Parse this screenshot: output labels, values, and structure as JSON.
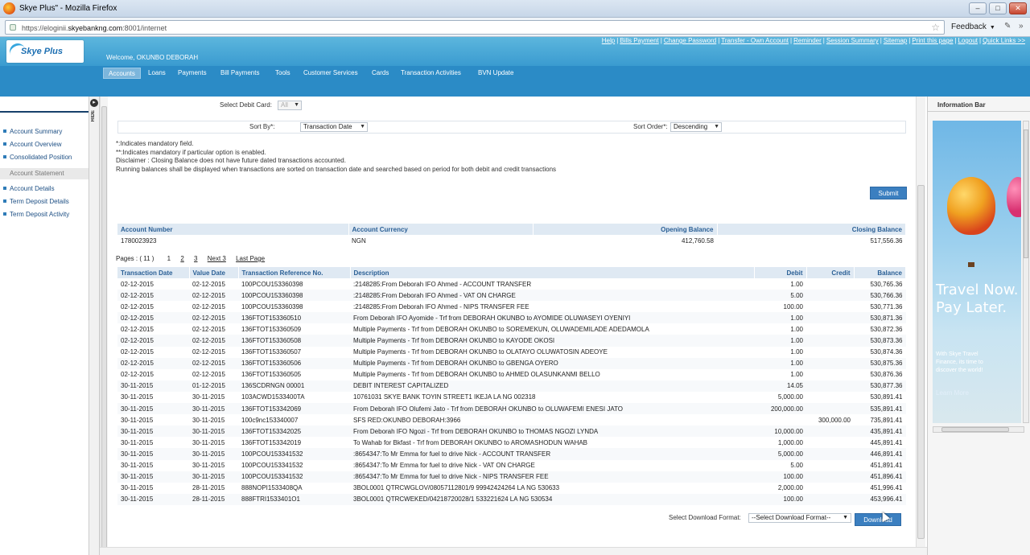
{
  "browser": {
    "window_title": "Skye Plus\" - Mozilla Firefox",
    "url_prefix": "https://eloginii.",
    "url_domain": "skyebankng.com",
    "url_suffix": ":8001/internet",
    "feedback_label": "Feedback",
    "minimize": "–",
    "maximize": "□",
    "close": "✕"
  },
  "header": {
    "logo_text": "Skye Plus",
    "welcome": "Welcome, OKUNBO DEBORAH",
    "quick_links": [
      "Help",
      "Bills Payment",
      "Change Password",
      "Transfer - Own Account",
      "Reminder",
      "Session Summary",
      "Sitemap",
      "Print this page",
      "Logout",
      "Quick Links >>"
    ]
  },
  "nav": {
    "items": [
      "Accounts",
      "Loans",
      "Payments",
      "Bill Payments",
      "Tools",
      "Customer Services",
      "Cards",
      "Transaction Activities",
      "BVN Update"
    ],
    "active": "Accounts"
  },
  "sidebar": {
    "hide_label": "HIDE",
    "items": [
      "Account Summary",
      "Account Overview",
      "Consolidated Position",
      "Account Statement",
      "Account Details",
      "Term Deposit Details",
      "Term Deposit Activity"
    ],
    "selected": "Account Statement"
  },
  "filters": {
    "debit_card_label": "Select Debit Card:",
    "debit_card_value": "All",
    "sort_by_label": "Sort By*:",
    "sort_by_value": "Transaction Date",
    "sort_order_label": "Sort Order*:",
    "sort_order_value": "Descending"
  },
  "notes": [
    "*:Indicates mandatory field.",
    "**:Indicates mandatory if particular option is enabled.",
    "Disclaimer : Closing Balance does not have future dated transactions accounted.",
    "Running balances shall be displayed when transactions are sorted on transaction date and searched based on period for both debit and credit transactions"
  ],
  "submit_label": "Submit",
  "summary": {
    "headers": [
      "Account Number",
      "Account Currency",
      "Opening Balance",
      "Closing Balance"
    ],
    "row": [
      "1780023923",
      "NGN",
      "412,760.58",
      "517,556.36"
    ]
  },
  "pager": {
    "pages_label": "Pages : ( 11 )",
    "current": "1",
    "links": [
      "2",
      "3",
      "Next 3",
      "Last Page"
    ]
  },
  "transactions": {
    "headers": [
      "Transaction Date",
      "Value Date",
      "Transaction Reference No.",
      "Description",
      "Debit",
      "Credit",
      "Balance"
    ],
    "rows": [
      [
        "02-12-2015",
        "02-12-2015",
        "100PCOU153360398",
        ":2148285:From Deborah IFO Ahmed - ACCOUNT TRANSFER",
        "1.00",
        "",
        "530,765.36"
      ],
      [
        "02-12-2015",
        "02-12-2015",
        "100PCOU153360398",
        ":2148285:From Deborah IFO Ahmed - VAT ON CHARGE",
        "5.00",
        "",
        "530,766.36"
      ],
      [
        "02-12-2015",
        "02-12-2015",
        "100PCOU153360398",
        ":2148285:From Deborah IFO Ahmed - NIPS TRANSFER FEE",
        "100.00",
        "",
        "530,771.36"
      ],
      [
        "02-12-2015",
        "02-12-2015",
        "136FTOT153360510",
        "From Deborah IFO Ayomide - Trf from DEBORAH OKUNBO to AYOMIDE OLUWASEYI OYENIYI",
        "1.00",
        "",
        "530,871.36"
      ],
      [
        "02-12-2015",
        "02-12-2015",
        "136FTOT153360509",
        "Multiple Payments - Trf from DEBORAH OKUNBO to SOREMEKUN, OLUWADEMILADE ADEDAMOLA",
        "1.00",
        "",
        "530,872.36"
      ],
      [
        "02-12-2015",
        "02-12-2015",
        "136FTOT153360508",
        "Multiple Payments - Trf from DEBORAH OKUNBO to KAYODE OKOSI",
        "1.00",
        "",
        "530,873.36"
      ],
      [
        "02-12-2015",
        "02-12-2015",
        "136FTOT153360507",
        "Multiple Payments - Trf from DEBORAH OKUNBO to OLATAYO OLUWATOSIN ADEOYE",
        "1.00",
        "",
        "530,874.36"
      ],
      [
        "02-12-2015",
        "02-12-2015",
        "136FTOT153360506",
        "Multiple Payments - Trf from DEBORAH OKUNBO to GBENGA OYERO",
        "1.00",
        "",
        "530,875.36"
      ],
      [
        "02-12-2015",
        "02-12-2015",
        "136FTOT153360505",
        "Multiple Payments - Trf from DEBORAH OKUNBO to AHMED OLASUNKANMI BELLO",
        "1.00",
        "",
        "530,876.36"
      ],
      [
        "30-11-2015",
        "01-12-2015",
        "136SCDRNGN 00001",
        "DEBIT INTEREST CAPITALIZED",
        "14.05",
        "",
        "530,877.36"
      ],
      [
        "30-11-2015",
        "30-11-2015",
        "103ACWD1533400TA",
        "10761031 SKYE BANK TOYIN STREET1 IKEJA LA NG 002318",
        "5,000.00",
        "",
        "530,891.41"
      ],
      [
        "30-11-2015",
        "30-11-2015",
        "136FTOT153342069",
        "From Deborah IFO Olufemi Jato - Trf from DEBORAH OKUNBO to OLUWAFEMI ENESI JATO",
        "200,000.00",
        "",
        "535,891.41"
      ],
      [
        "30-11-2015",
        "30-11-2015",
        "100c9nc153340007",
        "SFS RED:OKUNBO DEBORAH:3966",
        "",
        "300,000.00",
        "735,891.41"
      ],
      [
        "30-11-2015",
        "30-11-2015",
        "136FTOT153342025",
        "From Deborah IFO Ngozi - Trf from DEBORAH OKUNBO to THOMAS NGOZI LYNDA",
        "10,000.00",
        "",
        "435,891.41"
      ],
      [
        "30-11-2015",
        "30-11-2015",
        "136FTOT153342019",
        "To Wahab for Bkfast - Trf from DEBORAH OKUNBO to AROMASHODUN WAHAB",
        "1,000.00",
        "",
        "445,891.41"
      ],
      [
        "30-11-2015",
        "30-11-2015",
        "100PCOU153341532",
        ":8654347:To Mr Emma for fuel to drive Nick - ACCOUNT TRANSFER",
        "5,000.00",
        "",
        "446,891.41"
      ],
      [
        "30-11-2015",
        "30-11-2015",
        "100PCOU153341532",
        ":8654347:To Mr Emma for fuel to drive Nick - VAT ON CHARGE",
        "5.00",
        "",
        "451,891.41"
      ],
      [
        "30-11-2015",
        "30-11-2015",
        "100PCOU153341532",
        ":8654347:To Mr Emma for fuel to drive Nick - NIPS TRANSFER FEE",
        "100.00",
        "",
        "451,896.41"
      ],
      [
        "30-11-2015",
        "28-11-2015",
        "888NOPI1533408QA",
        "3BOL0001 QTRCWGLOV/08057112801/9 99942424264 LA NG 530633",
        "2,000.00",
        "",
        "451,996.41"
      ],
      [
        "30-11-2015",
        "28-11-2015",
        "888FTRI1533401O1",
        "3BOL0001 QTRCWEKED/04218720028/1 533221624 LA NG 530534",
        "100.00",
        "",
        "453,996.41"
      ]
    ]
  },
  "download": {
    "label": "Select Download Format:",
    "select_value": "--Select Download Format--",
    "button_label": "Download"
  },
  "infobar": {
    "title": "Information Bar",
    "ad_headline": "Travel Now. Pay Later.",
    "ad_body": "With Skye Travel Finance, its time to discover the world!",
    "ad_cta": "Learn More"
  },
  "colors": {
    "header_blue": "#3a9bd0",
    "nav_blue": "#2b8bc6",
    "button_blue": "#3b7fc0",
    "table_header_bg": "#dfe9f3",
    "table_header_text": "#2a5f95"
  }
}
